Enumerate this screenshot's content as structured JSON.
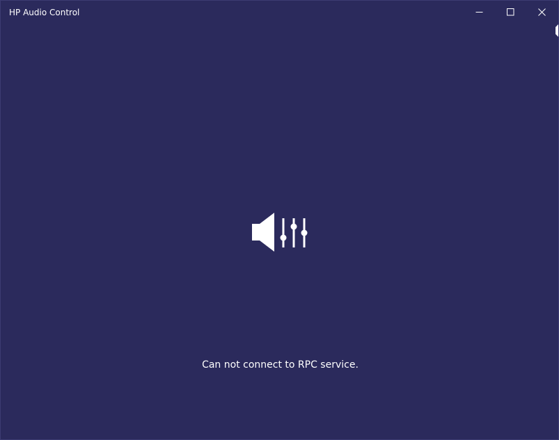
{
  "window": {
    "title": "HP Audio Control",
    "controls": {
      "minimize": "minimize-icon",
      "maximize": "maximize-icon",
      "close": "close-icon"
    }
  },
  "main": {
    "icon": "speaker-equalizer-icon",
    "status_message": "Can not connect to RPC service."
  },
  "colors": {
    "background": "#2b2a5c",
    "foreground": "#ffffff"
  }
}
